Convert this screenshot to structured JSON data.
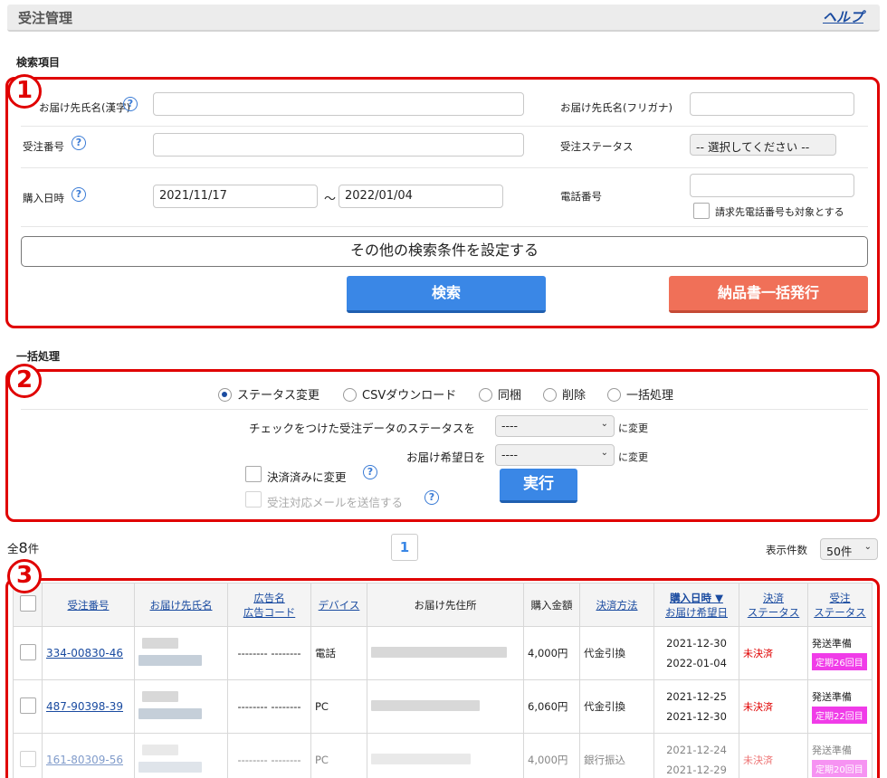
{
  "header": {
    "title": "受注管理",
    "help": "ヘルプ"
  },
  "search": {
    "section_label": "検索項目",
    "marker": "1",
    "name_kanji_label": "お届け先氏名(漢字)",
    "name_kana_label": "お届け先氏名(フリガナ)",
    "order_no_label": "受注番号",
    "status_label": "受注ステータス",
    "status_select": "-- 選択してください --",
    "date_label": "購入日時",
    "date_from": "2021/11/17",
    "date_sep": "～",
    "date_to": "2022/01/04",
    "phone_label": "電話番号",
    "phone_billing_label": "請求先電話番号も対象とする",
    "more_conditions": "その他の検索条件を設定する",
    "search_button": "検索",
    "bulk_invoice_button": "納品書一括発行"
  },
  "bulk": {
    "section_label": "一括処理",
    "marker": "2",
    "radios": [
      "ステータス変更",
      "CSVダウンロード",
      "同梱",
      "削除",
      "一括処理"
    ],
    "status_change_label": "チェックをつけた受注データのステータスを",
    "status_change_select": "----",
    "status_change_suffix": "に変更",
    "delivery_date_label": "お届け希望日を",
    "delivery_date_select": "----",
    "delivery_date_suffix": "に変更",
    "paid_label": "決済済みに変更",
    "mail_label": "受注対応メールを送信する",
    "execute_button": "実行"
  },
  "listing": {
    "total_prefix": "全",
    "total_count": "8",
    "total_suffix": "件",
    "page": "1",
    "per_page_label": "表示件数",
    "per_page_value": "50件",
    "marker": "3"
  },
  "table": {
    "headers": {
      "order_no": "受注番号",
      "name": "お届け先氏名",
      "ad_name": "広告名",
      "ad_code": "広告コード",
      "device": "デバイス",
      "address": "お届け先住所",
      "amount": "購入金額",
      "payment": "決済方法",
      "purchase_date": "購入日時 ▼",
      "delivery_date": "お届け希望日",
      "pay_status_1": "決済",
      "pay_status_2": "ステータス",
      "order_status_1": "受注",
      "order_status_2": "ステータス"
    },
    "rows": [
      {
        "order_no": "334-00830-46",
        "ad": "-------- --------",
        "device": "電話",
        "amount": "4,000円",
        "payment": "代金引換",
        "purchase": "2021-12-30",
        "delivery": "2022-01-04",
        "pay_status": "未決済",
        "status": "発送準備",
        "badge": "定期26回目"
      },
      {
        "order_no": "487-90398-39",
        "ad": "-------- --------",
        "device": "PC",
        "amount": "6,060円",
        "payment": "代金引換",
        "purchase": "2021-12-25",
        "delivery": "2021-12-30",
        "pay_status": "未決済",
        "status": "発送準備",
        "badge": "定期22回目"
      },
      {
        "order_no": "161-80309-56",
        "ad": "-------- --------",
        "device": "PC",
        "amount": "4,000円",
        "payment": "銀行振込",
        "purchase": "2021-12-24",
        "delivery": "2021-12-29",
        "pay_status": "未決済",
        "status": "発送準備",
        "badge": "定期20回目"
      }
    ]
  },
  "colors": {
    "accent_red": "#e00000",
    "primary_blue": "#3a87e6",
    "orange": "#f07058",
    "badge_pink": "#f03ce8",
    "link": "#1a4ba0"
  }
}
